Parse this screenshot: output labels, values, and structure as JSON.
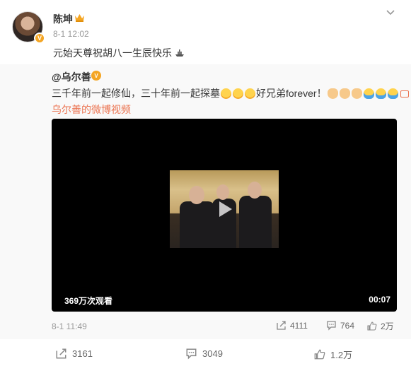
{
  "post": {
    "author": "陈坤",
    "time": "8-1 12:02",
    "text": "元始天尊祝胡八一生辰快乐",
    "icons": {
      "more": "chevron-down-icon",
      "verified": "verified-v-icon",
      "crown": "crown-icon",
      "ship": "ship-emoji-icon"
    }
  },
  "repost": {
    "author": "@乌尔善",
    "text_parts": [
      "三千年前一起修仙，三十年前一起探墓",
      "好兄弟forever！"
    ],
    "link_text": "乌尔善的微博视频",
    "video": {
      "views": "369万次观看",
      "duration": "00:07"
    },
    "time": "8-1 11:49",
    "stats": {
      "repost": "4111",
      "comment": "764",
      "like": "2万"
    }
  },
  "actions": {
    "repost": "3161",
    "comment": "3049",
    "like": "1.2万"
  },
  "colors": {
    "accent": "#eb7350",
    "verified": "#f4a523",
    "repost_bg": "#f9f9f9",
    "video_bg": "#000000"
  }
}
